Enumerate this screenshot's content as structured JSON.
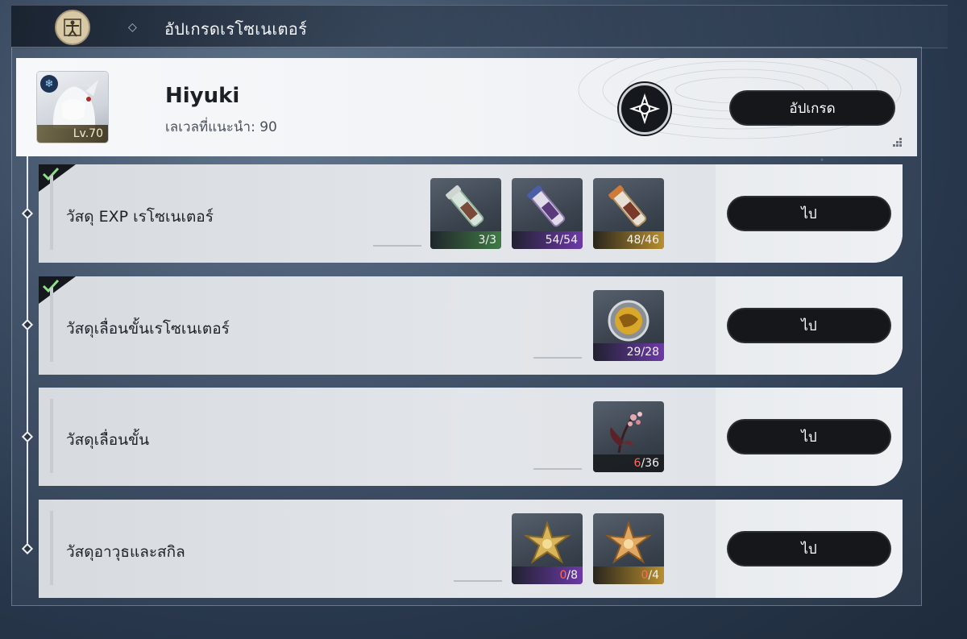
{
  "header": {
    "title": "อัปเกรดเรโซเนเตอร์",
    "emblem": "vitruvian-emblem-icon"
  },
  "character": {
    "name": "Hiyuki",
    "level_label": "Lv.70",
    "recommended_level": "เลเวลที่แนะนำ: 90",
    "element_icon": "snowflake-icon",
    "upgrade_label": "อัปเกรด"
  },
  "rows": [
    {
      "label": "วัสดุ EXP เรโซเนเตอร์",
      "completed": true,
      "go_label": "ไป",
      "items": [
        {
          "have": "3",
          "need": "3",
          "rarity": "green",
          "icon": "exp-tube-green-icon",
          "enough": true
        },
        {
          "have": "54",
          "need": "54",
          "rarity": "purple",
          "icon": "exp-tube-purple-icon",
          "enough": true
        },
        {
          "have": "48",
          "need": "46",
          "rarity": "gold",
          "icon": "exp-tube-gold-icon",
          "enough": true
        }
      ]
    },
    {
      "label": "วัสดุเลื่อนขั้นเรโซเนเตอร์",
      "completed": true,
      "go_label": "ไป",
      "items": [
        {
          "have": "29",
          "need": "28",
          "rarity": "purple",
          "icon": "golden-core-icon",
          "enough": true
        }
      ]
    },
    {
      "label": "วัสดุเลื่อนขั้น",
      "completed": false,
      "go_label": "ไป",
      "items": [
        {
          "have": "6",
          "need": "36",
          "rarity": "gray",
          "icon": "flower-plant-icon",
          "enough": false
        }
      ]
    },
    {
      "label": "วัสดุอาวุธและสกิล",
      "completed": false,
      "go_label": "ไป",
      "items": [
        {
          "have": "0",
          "need": "8",
          "rarity": "purple",
          "icon": "star-crystal-gold-icon",
          "enough": false
        },
        {
          "have": "0",
          "need": "4",
          "rarity": "gold",
          "icon": "star-crystal-gold-icon",
          "enough": false
        }
      ]
    }
  ],
  "colors": {
    "button_bg": "#15171b",
    "insufficient": "#ff6a5a",
    "check": "#8fe08a"
  }
}
